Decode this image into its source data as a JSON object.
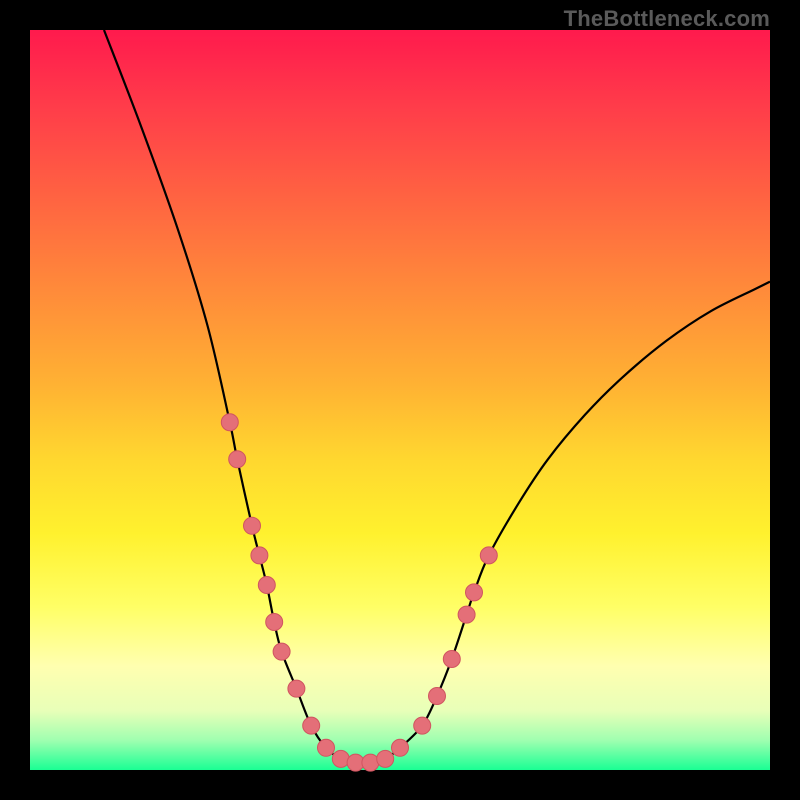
{
  "attribution": "TheBottleneck.com",
  "colors": {
    "gradient_top": "#ff1a4d",
    "gradient_bottom": "#1aff94",
    "curve": "#000000",
    "marker_fill": "#e46f78",
    "marker_stroke": "#d05560",
    "frame": "#000000"
  },
  "chart_data": {
    "type": "line",
    "title": "",
    "xlabel": "",
    "ylabel": "",
    "xlim": [
      0,
      100
    ],
    "ylim": [
      0,
      100
    ],
    "series": [
      {
        "name": "bottleneck-curve",
        "x": [
          10,
          15,
          20,
          24,
          27,
          28,
          30,
          31,
          32,
          33,
          34,
          36,
          38,
          40,
          42,
          44,
          46,
          48,
          50,
          53,
          55,
          57,
          59,
          60,
          62,
          66,
          70,
          75,
          80,
          86,
          92,
          98,
          100
        ],
        "y": [
          100,
          87,
          73,
          60,
          47,
          42,
          33,
          29,
          25,
          20,
          16,
          11,
          6,
          3,
          1.5,
          1,
          1,
          1.5,
          3,
          6,
          10,
          15,
          21,
          24,
          29,
          36,
          42,
          48,
          53,
          58,
          62,
          65,
          66
        ]
      }
    ],
    "markers": {
      "name": "highlight-points",
      "x": [
        27,
        28,
        30,
        31,
        32,
        33,
        34,
        36,
        38,
        40,
        42,
        44,
        46,
        48,
        50,
        53,
        55,
        57,
        59,
        60,
        62
      ],
      "y": [
        47,
        42,
        33,
        29,
        25,
        20,
        16,
        11,
        6,
        3,
        1.5,
        1,
        1,
        1.5,
        3,
        6,
        10,
        15,
        21,
        24,
        29
      ]
    },
    "background_gradient": {
      "direction": "vertical",
      "stops": [
        {
          "pos": 0,
          "meaning": "high-bottleneck",
          "color": "#ff1a4d"
        },
        {
          "pos": 100,
          "meaning": "no-bottleneck",
          "color": "#1aff94"
        }
      ]
    }
  }
}
